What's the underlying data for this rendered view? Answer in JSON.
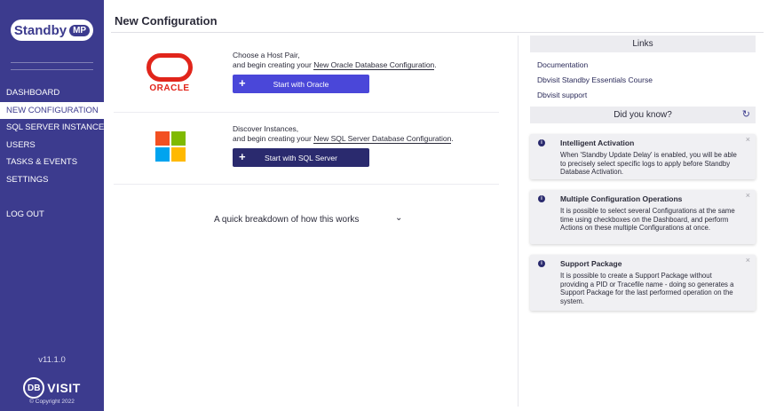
{
  "sidebar": {
    "logo_text": "Standby",
    "logo_badge": "MP",
    "nav": [
      {
        "label": "DASHBOARD",
        "active": false
      },
      {
        "label": "NEW CONFIGURATION",
        "active": true
      },
      {
        "label": "SQL SERVER INSTANCES",
        "active": false
      },
      {
        "label": "USERS",
        "active": false
      },
      {
        "label": "TASKS & EVENTS",
        "active": false
      },
      {
        "label": "SETTINGS",
        "active": false
      }
    ],
    "logout": "LOG OUT",
    "version": "v11.1.0",
    "brand_circle": "DB",
    "brand_word": "VISIT",
    "copyright": "© Copyright 2022"
  },
  "header": {
    "title": "New Configuration"
  },
  "oracle": {
    "logo_word": "ORACLE",
    "line1": "Choose a Host Pair,",
    "line2_prefix": "and begin creating your",
    "link": "New Oracle Database Configuration",
    "line2_suffix": ".",
    "button_label": "Start with Oracle",
    "button_icon": "+"
  },
  "sqlserver": {
    "line1": "Discover Instances,",
    "line2_prefix": "and begin creating your",
    "link": "New SQL Server Database Configuration",
    "line2_suffix": ".",
    "button_label": "Start with SQL Server",
    "button_icon": "+"
  },
  "breakdown": {
    "label": "A quick breakdown of how this works",
    "chevron": "⌄"
  },
  "links_panel": {
    "title": "Links",
    "items": [
      "Documentation",
      "Dbvisit Standby Essentials Course",
      "Dbvisit support"
    ]
  },
  "did_you_know": {
    "title": "Did you know?",
    "refresh_icon": "↻",
    "cards": [
      {
        "title": "Intelligent Activation",
        "text": "When 'Standby Update Delay' is enabled, you will be able to precisely select specific logs to apply before Standby Database Activation."
      },
      {
        "title": "Multiple Configuration Operations",
        "text": "It is possible to select several Configurations at the same time using checkboxes on the Dashboard, and perform Actions on these multiple Configurations at once."
      },
      {
        "title": "Support Package",
        "text": "It is possible to create a Support Package without providing a PID or Tracefile name - doing so generates a Support Package for the last performed operation on the system."
      }
    ],
    "info_icon": "i",
    "close_icon": "×"
  },
  "colors": {
    "sidebar": "#3c3b8e",
    "oracle_button": "#4a47d9",
    "sql_button": "#2a2a6e",
    "oracle_red": "#e1251b",
    "ms_red": "#f25022",
    "ms_green": "#7fba00",
    "ms_blue": "#00a4ef",
    "ms_yellow": "#ffb900"
  }
}
